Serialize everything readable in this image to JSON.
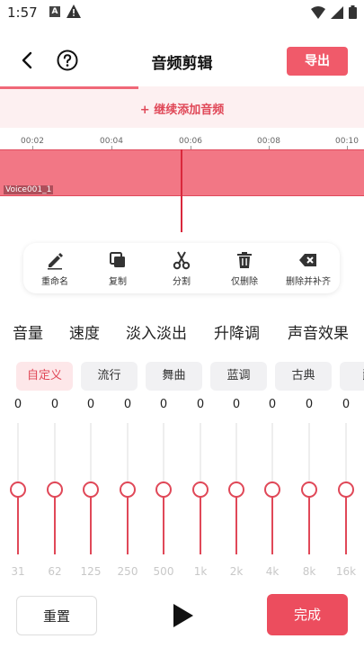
{
  "status_bar": {
    "time": "1:57",
    "notification_icons": [
      "a-icon",
      "warning-icon"
    ],
    "system_icons": [
      "wifi-icon",
      "signal-icon",
      "battery-icon"
    ]
  },
  "header": {
    "title": "音频剪辑",
    "export_label": "导出"
  },
  "add_audio": {
    "label": "+ 继续添加音频",
    "accent": "#f06878"
  },
  "timeline": {
    "ticks": [
      "00:02",
      "00:04",
      "00:06",
      "00:08",
      "00:10"
    ],
    "track_label": "Voice001_1",
    "track_color": "#f27785"
  },
  "tools": [
    {
      "icon": "pencil-icon",
      "label": "重命名"
    },
    {
      "icon": "copy-icon",
      "label": "复制"
    },
    {
      "icon": "scissors-icon",
      "label": "分割"
    },
    {
      "icon": "trash-icon",
      "label": "仅删除"
    },
    {
      "icon": "backspace-icon",
      "label": "删除并补齐"
    }
  ],
  "feature_tabs": [
    "音量",
    "速度",
    "淡入淡出",
    "升降调",
    "声音效果"
  ],
  "presets": [
    {
      "label": "自定义",
      "active": true
    },
    {
      "label": "流行",
      "active": false
    },
    {
      "label": "舞曲",
      "active": false
    },
    {
      "label": "蓝调",
      "active": false
    },
    {
      "label": "古典",
      "active": false
    },
    {
      "label": "爵",
      "active": false
    }
  ],
  "equalizer": {
    "bands": [
      {
        "freq": "31",
        "value": "0"
      },
      {
        "freq": "62",
        "value": "0"
      },
      {
        "freq": "125",
        "value": "0"
      },
      {
        "freq": "250",
        "value": "0"
      },
      {
        "freq": "500",
        "value": "0"
      },
      {
        "freq": "1k",
        "value": "0"
      },
      {
        "freq": "2k",
        "value": "0"
      },
      {
        "freq": "4k",
        "value": "0"
      },
      {
        "freq": "8k",
        "value": "0"
      },
      {
        "freq": "16k",
        "value": "0"
      }
    ],
    "accent": "#e04858"
  },
  "bottom": {
    "reset_label": "重置",
    "done_label": "完成"
  }
}
